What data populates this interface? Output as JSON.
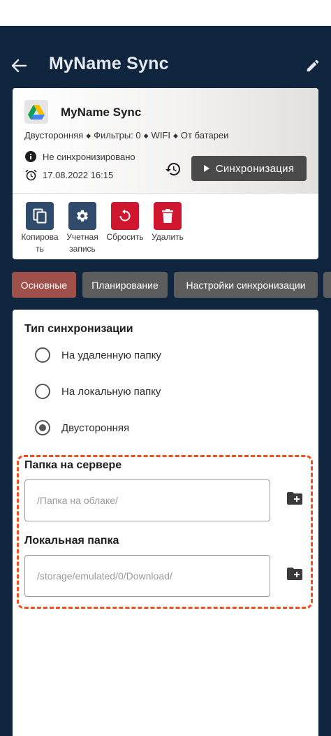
{
  "app_bar": {
    "title": "MyName Sync",
    "back_icon": "arrow-left-icon",
    "edit_icon": "pencil-icon"
  },
  "card": {
    "title": "MyName Sync",
    "tags": [
      "Двусторонняя",
      "Фильтры: 0",
      "WIFI",
      "От батареи"
    ],
    "status": "Не синхронизировано",
    "datetime": "17.08.2022 16:15",
    "sync_button": "Синхронизация",
    "actions": [
      {
        "label": "Копирова ть",
        "icon": "copy-icon",
        "color": "#2f4a6b"
      },
      {
        "label": "Учетная запись",
        "icon": "gear-icon",
        "color": "#2f4a6b"
      },
      {
        "label": "Сбросить",
        "icon": "reset-icon",
        "color": "#d0162e"
      },
      {
        "label": "Удалить",
        "icon": "trash-icon",
        "color": "#d0162e"
      }
    ]
  },
  "tabs": [
    {
      "label": "Основные",
      "active": true
    },
    {
      "label": "Планирование",
      "active": false
    },
    {
      "label": "Настройки синхронизации",
      "active": false
    }
  ],
  "sync_type": {
    "title": "Тип синхронизации",
    "options": [
      {
        "label": "На удаленную папку",
        "selected": false
      },
      {
        "label": "На локальную папку",
        "selected": false
      },
      {
        "label": "Двусторонняя",
        "selected": true
      }
    ]
  },
  "server_folder": {
    "title": "Папка на сервере",
    "placeholder": "/Папка на облаке/"
  },
  "local_folder": {
    "title": "Локальная папка",
    "value": "/storage/emulated/0/Download/"
  },
  "colors": {
    "background": "#10263f",
    "tab_active": "#a0504a",
    "tab_inactive": "#5d5d5d",
    "highlight": "#f04e1c"
  }
}
